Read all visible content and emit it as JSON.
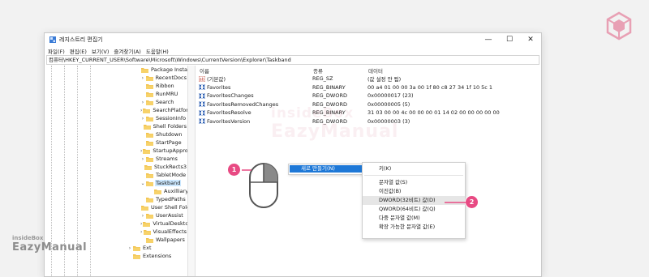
{
  "window": {
    "title": "레지스트리 편집기",
    "controls": [
      "—",
      "☐",
      "✕"
    ]
  },
  "menu": [
    "파일(F)",
    "편집(E)",
    "보기(V)",
    "즐겨찾기(A)",
    "도움말(H)"
  ],
  "address": "컴퓨터\\HKEY_CURRENT_USER\\Software\\Microsoft\\Windows\\CurrentVersion\\Explorer\\Taskband",
  "tree": [
    {
      "label": "Package Installation",
      "chevron": "",
      "selected": false
    },
    {
      "label": "RecentDocs",
      "chevron": "›",
      "selected": false
    },
    {
      "label": "Ribbon",
      "chevron": "",
      "selected": false
    },
    {
      "label": "RunMRU",
      "chevron": "",
      "selected": false
    },
    {
      "label": "Search",
      "chevron": "›",
      "selected": false
    },
    {
      "label": "SearchPlatform",
      "chevron": "›",
      "selected": false
    },
    {
      "label": "SessionInfo",
      "chevron": "›",
      "selected": false
    },
    {
      "label": "Shell Folders",
      "chevron": "",
      "selected": false
    },
    {
      "label": "Shutdown",
      "chevron": "",
      "selected": false
    },
    {
      "label": "StartPage",
      "chevron": "",
      "selected": false
    },
    {
      "label": "StartupApproved",
      "chevron": "›",
      "selected": false
    },
    {
      "label": "Streams",
      "chevron": "›",
      "selected": false
    },
    {
      "label": "StuckRects3",
      "chevron": "",
      "selected": false
    },
    {
      "label": "TabletMode",
      "chevron": "",
      "selected": false
    },
    {
      "label": "Taskband",
      "chevron": "⌄",
      "selected": true
    },
    {
      "label": "AuxilliaryPins",
      "chevron": "",
      "selected": false,
      "child": true
    },
    {
      "label": "TypedPaths",
      "chevron": "",
      "selected": false
    },
    {
      "label": "User Shell Folders",
      "chevron": "",
      "selected": false
    },
    {
      "label": "UserAssist",
      "chevron": "›",
      "selected": false
    },
    {
      "label": "VirtualDesktops",
      "chevron": "›",
      "selected": false
    },
    {
      "label": "VisualEffects",
      "chevron": "›",
      "selected": false
    },
    {
      "label": "Wallpapers",
      "chevron": "",
      "selected": false
    },
    {
      "label": "Ext",
      "chevron": "›",
      "selected": false,
      "outer": true
    },
    {
      "label": "Extensions",
      "chevron": "",
      "selected": false,
      "outer": true
    }
  ],
  "columns": {
    "name": "이름",
    "type": "종류",
    "data": "데이터"
  },
  "values": [
    {
      "name": "(기본값)",
      "type": "REG_SZ",
      "data": "(값 설정 안 됨)",
      "icon": "string-value-icon"
    },
    {
      "name": "Favorites",
      "type": "REG_BINARY",
      "data": "00 a4 01 00 00 3a 00 1f 80 c8 27 34 1f 10 5c 1",
      "icon": "binary-value-icon"
    },
    {
      "name": "FavoritesChanges",
      "type": "REG_DWORD",
      "data": "0x00000017 (23)",
      "icon": "binary-value-icon"
    },
    {
      "name": "FavoritesRemovedChanges",
      "type": "REG_DWORD",
      "data": "0x00000005 (5)",
      "icon": "binary-value-icon"
    },
    {
      "name": "FavoritesResolve",
      "type": "REG_BINARY",
      "data": "31 03 00 00 4c 00 00 00 01 14 02 00 00 00 00 00",
      "icon": "binary-value-icon"
    },
    {
      "name": "FavoritesVersion",
      "type": "REG_DWORD",
      "data": "0x00000003 (3)",
      "icon": "binary-value-icon"
    }
  ],
  "context_menu": {
    "new_label": "새로 만들기(N)"
  },
  "submenu": {
    "items": [
      {
        "label": "키(K)",
        "highlight": false
      },
      {
        "label": "문자열 값(S)",
        "highlight": false
      },
      {
        "label": "이진값(B)",
        "highlight": false
      },
      {
        "label": "DWORD(32비트) 값(D)",
        "highlight": true
      },
      {
        "label": "QWORD(64비트) 값(Q)",
        "highlight": false
      },
      {
        "label": "다중 문자열 값(M)",
        "highlight": false
      },
      {
        "label": "확장 가능한 문자열 값(E)",
        "highlight": false
      }
    ]
  },
  "markers": {
    "step1": "1",
    "step2": "2"
  },
  "watermark": {
    "small": "insideBox",
    "big": "EazyManual"
  },
  "brand": {
    "small": "insideBox",
    "big": "EazyManual"
  },
  "colors": {
    "accent": "#1e78d7",
    "marker": "#e84a83",
    "folder": "#f2c14e",
    "selection": "#cce8ff"
  }
}
